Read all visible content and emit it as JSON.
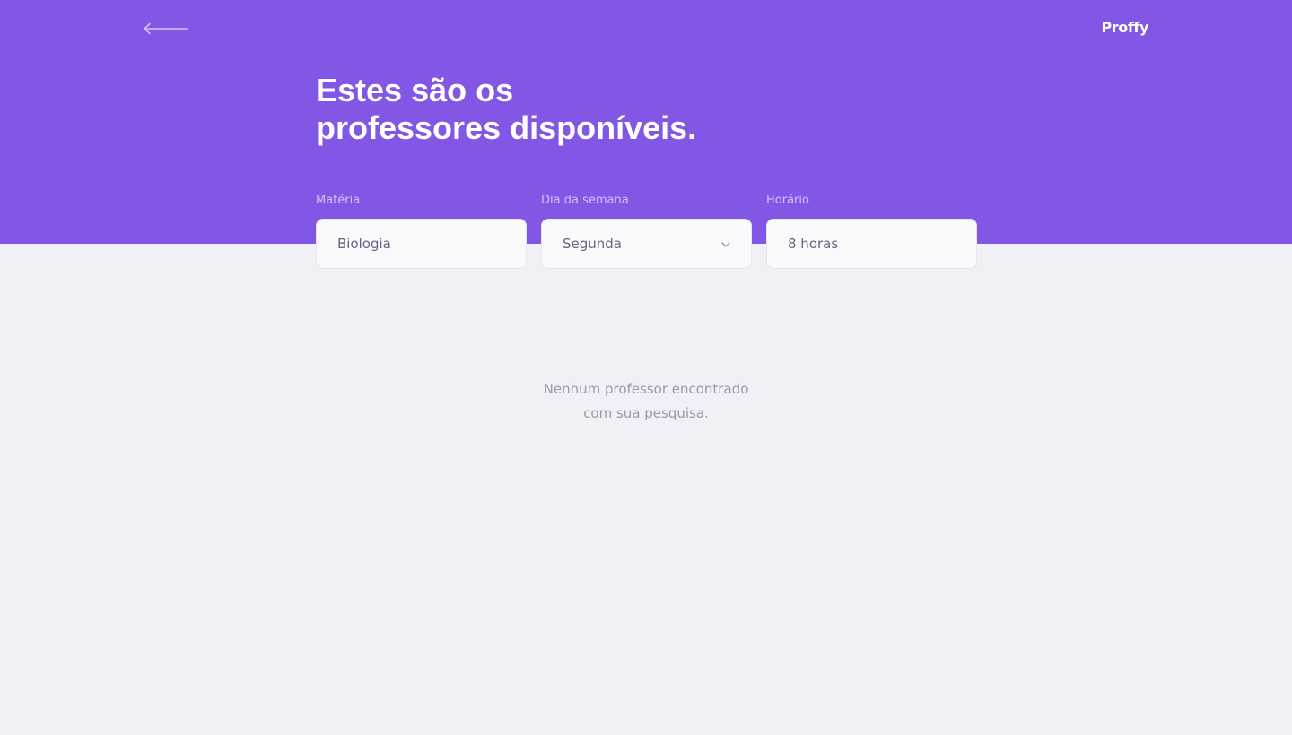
{
  "header": {
    "back_icon": "arrow-left-icon",
    "logo_text": "Proffy",
    "title_line1": "Estes são os",
    "title_line2": "professores disponíveis."
  },
  "filters": {
    "subject": {
      "label": "Matéria",
      "value": "Biologia"
    },
    "week_day": {
      "label": "Dia da semana",
      "value": "Segunda",
      "icon": "chevron-down-icon"
    },
    "time": {
      "label": "Horário",
      "value": "8 horas"
    }
  },
  "results": {
    "empty_line1": "Nenhum professor encontrado",
    "empty_line2": "com sua pesquisa."
  },
  "colors": {
    "primary": "#8257E5",
    "background": "#F0F0F7",
    "input_background": "#FAFAFC",
    "label": "#D4C2FF",
    "input_text": "#6A6180",
    "muted_text": "#9C98A6"
  }
}
